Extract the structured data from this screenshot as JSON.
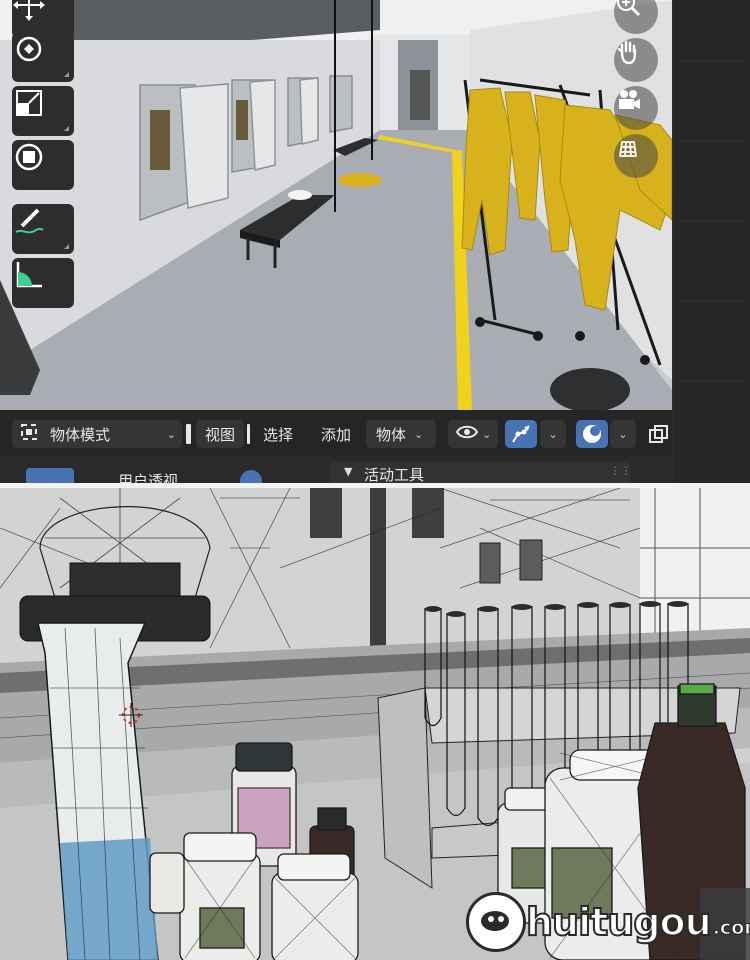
{
  "header": {
    "mode_label": "物体模式",
    "view_label": "视图",
    "select_label": "选择",
    "add_label": "添加",
    "object_label": "物体"
  },
  "subheader": {
    "tab_label": "用户透视",
    "active_tool_label": "活动工具"
  },
  "watermark": {
    "brand": "huitugou",
    "domain": ".com"
  },
  "colors": {
    "blender_dark": "#252525",
    "accent_blue": "#4772b3",
    "suit_yellow": "#d8b21c",
    "floor_line": "#f0d21c"
  }
}
